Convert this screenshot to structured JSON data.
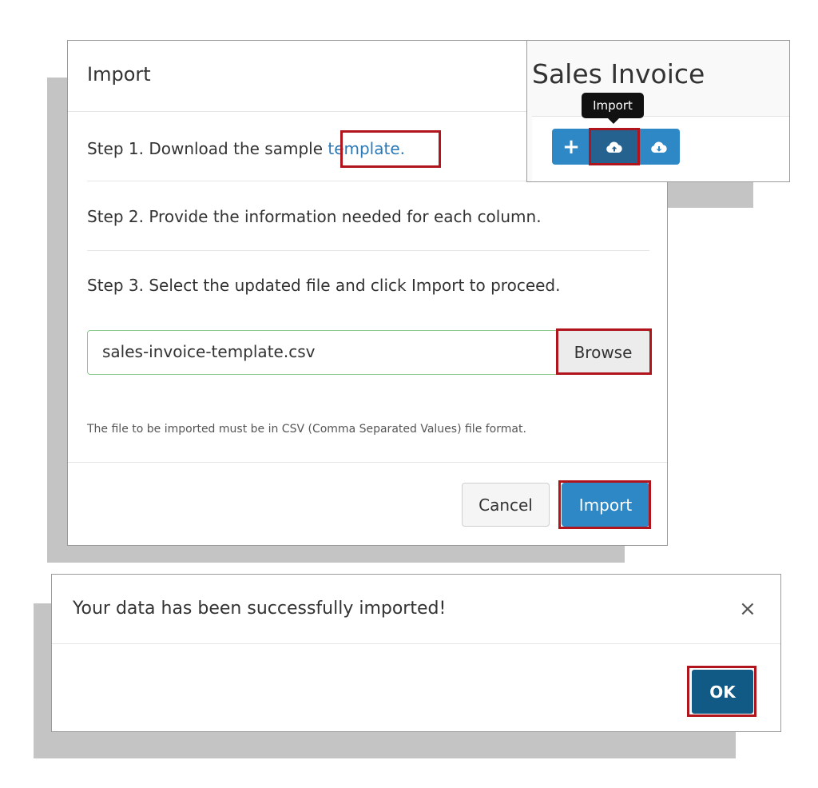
{
  "import_modal": {
    "title": "Import",
    "step1_text": "Step 1. Download the sample ",
    "step1_link": "template.",
    "step2_text": "Step 2. Provide the information needed for each column.",
    "step3_text": "Step 3. Select the updated file and click Import to proceed.",
    "file_value": "sales-invoice-template.csv",
    "browse_label": "Browse",
    "note": "The file to be imported must be in CSV (Comma Separated Values) file format.",
    "cancel_label": "Cancel",
    "import_label": "Import"
  },
  "sales_panel": {
    "title": "Sales Invoice",
    "tooltip": "Import",
    "add_label": "+",
    "icons": [
      "plus-icon",
      "cloud-upload-icon",
      "cloud-download-icon"
    ]
  },
  "success_dialog": {
    "message": "Your data has been successfully imported!",
    "close_label": "×",
    "ok_label": "OK"
  },
  "colors": {
    "primary": "#2f88c6",
    "primary_dark": "#25628f",
    "ok_button": "#115a86",
    "highlight": "#b0141c",
    "input_border": "#8bc98a"
  }
}
